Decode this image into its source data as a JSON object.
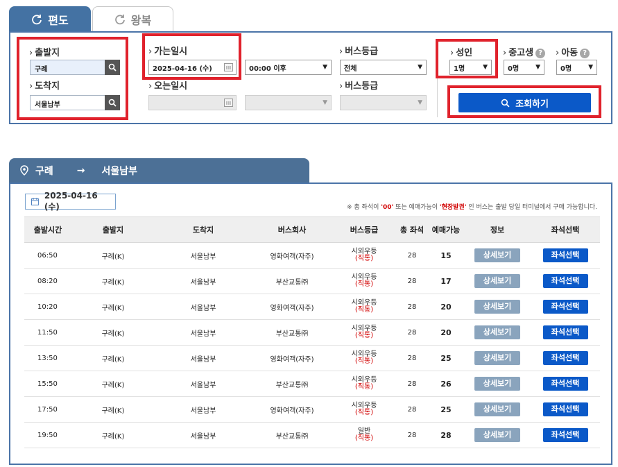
{
  "tabs": [
    {
      "label": "편도",
      "active": true
    },
    {
      "label": "왕복",
      "active": false
    }
  ],
  "search": {
    "departure_label": "출발지",
    "departure_value": "구례",
    "arrival_label": "도착지",
    "arrival_value": "서울남부",
    "go_date_label": "가는일시",
    "go_date_value": "2025-04-16 (수)",
    "go_time_value": "00:00 이후",
    "return_date_label": "오는일시",
    "bus_grade_label": "버스등급",
    "bus_grade_value": "전체",
    "return_bus_grade_label": "버스등급",
    "adult_label": "성인",
    "adult_value": "1명",
    "youth_label": "중고생",
    "youth_value": "0명",
    "child_label": "아동",
    "child_value": "0명",
    "help_mark": "?",
    "query_button": "조회하기"
  },
  "results": {
    "route_from": "구례",
    "route_arrow": "→",
    "route_to": "서울남부",
    "date_badge": "2025-04-16 (수)",
    "notice_prefix": "※ 총 좌석이 ",
    "notice_zero": "'00'",
    "notice_mid": " 또는 예매가능이 ",
    "notice_onsite": "'현장발권'",
    "notice_suffix": " 인 버스는 출발 당일 터미널에서 구매 가능합니다.",
    "columns": [
      "출발시간",
      "출발지",
      "도착지",
      "버스회사",
      "버스등급",
      "총 좌석",
      "예매가능",
      "정보",
      "좌석선택"
    ],
    "detail_label": "상세보기",
    "seat_label": "좌석선택",
    "rows": [
      {
        "time": "06:50",
        "from": "구례(K)",
        "to": "서울남부",
        "company": "영화여객(자주)",
        "grade": "시외우등",
        "grade_sub": "(직통)",
        "total": "28",
        "available": "15"
      },
      {
        "time": "08:20",
        "from": "구례(K)",
        "to": "서울남부",
        "company": "부산교통㈜",
        "grade": "시외우등",
        "grade_sub": "(직통)",
        "total": "28",
        "available": "17"
      },
      {
        "time": "10:20",
        "from": "구례(K)",
        "to": "서울남부",
        "company": "영화여객(자주)",
        "grade": "시외우등",
        "grade_sub": "(직통)",
        "total": "28",
        "available": "20"
      },
      {
        "time": "11:50",
        "from": "구례(K)",
        "to": "서울남부",
        "company": "부산교통㈜",
        "grade": "시외우등",
        "grade_sub": "(직통)",
        "total": "28",
        "available": "20"
      },
      {
        "time": "13:50",
        "from": "구례(K)",
        "to": "서울남부",
        "company": "영화여객(자주)",
        "grade": "시외우등",
        "grade_sub": "(직통)",
        "total": "28",
        "available": "25"
      },
      {
        "time": "15:50",
        "from": "구례(K)",
        "to": "서울남부",
        "company": "부산교통㈜",
        "grade": "시외우등",
        "grade_sub": "(직통)",
        "total": "28",
        "available": "26"
      },
      {
        "time": "17:50",
        "from": "구례(K)",
        "to": "서울남부",
        "company": "영화여객(자주)",
        "grade": "시외우등",
        "grade_sub": "(직통)",
        "total": "28",
        "available": "25"
      },
      {
        "time": "19:50",
        "from": "구례(K)",
        "to": "서울남부",
        "company": "부산교통㈜",
        "grade": "일반",
        "grade_sub": "(직통)",
        "total": "28",
        "available": "28"
      }
    ]
  },
  "colors": {
    "primary_blue": "#0b59c8",
    "panel_border": "#4b74a8",
    "tab_active": "#4472a3",
    "route_tab": "#4c7096",
    "detail_button": "#8aa4bd",
    "highlight_red": "#e0222c",
    "accent_red_text": "#d10000"
  },
  "icons": [
    "refresh-icon",
    "search-icon",
    "calendar-icon",
    "location-pin-icon",
    "help-icon",
    "dropdown-caret-icon"
  ]
}
